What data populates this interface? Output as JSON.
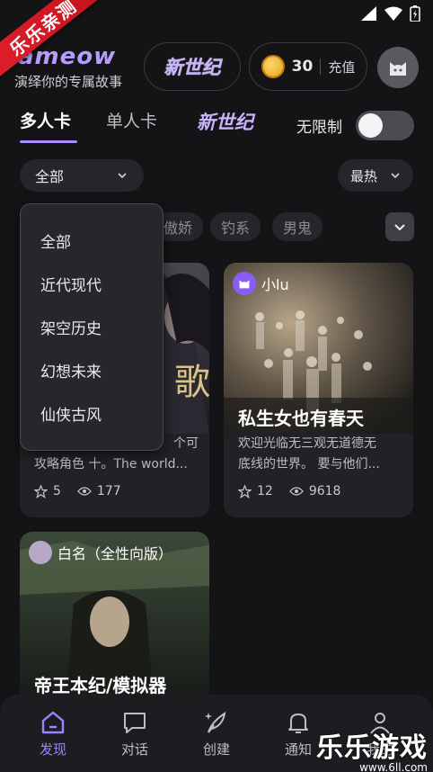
{
  "promo_ribbon": "乐乐亲测",
  "header": {
    "brand": "ameow",
    "slogan": "演绎你的专属故事",
    "xinshiji_logo": "新世纪",
    "coins": "30",
    "recharge": "充值"
  },
  "tabs": {
    "multi": "多人卡",
    "single": "单人卡",
    "xinshiji": "新世纪",
    "unlimited_label": "无限制"
  },
  "filter": {
    "category": "全部",
    "sort": "最热"
  },
  "chips": [
    "傲娇",
    "钓系",
    "男鬼"
  ],
  "dropdown": [
    "全部",
    "近代现代",
    "架空历史",
    "幻想未来",
    "仙侠古风"
  ],
  "cards": [
    {
      "title_art": "歌",
      "desc_line1": "个可",
      "desc_line2": "攻略角色 十。The world...",
      "stars": "5",
      "views": "177"
    },
    {
      "author": "小lu",
      "title": "私生女也有春天",
      "desc_line1": "欢迎光临无三观无道德无",
      "desc_line2": "底线的世界。 要与他们...",
      "stars": "12",
      "views": "9618"
    },
    {
      "author": "白名（全性向版）",
      "title": "帝王本纪/模拟器"
    }
  ],
  "nav": [
    {
      "label": "发现"
    },
    {
      "label": "对话"
    },
    {
      "label": "创建"
    },
    {
      "label": "通知"
    },
    {
      "label": "我的"
    }
  ],
  "watermark": {
    "big": "乐乐游戏",
    "small": "www.6ll.com"
  },
  "colors": {
    "accent": "#9d82ff",
    "background": "#141416"
  }
}
